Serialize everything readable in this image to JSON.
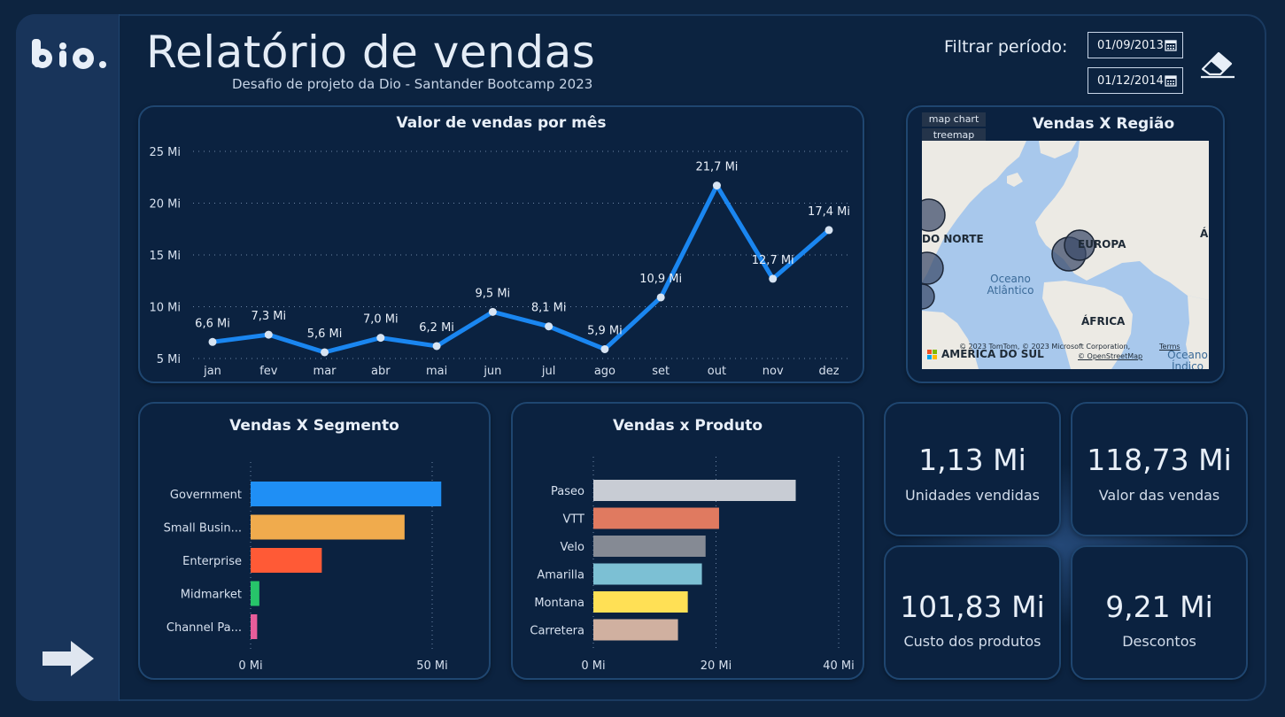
{
  "header": {
    "title": "Relatório de vendas",
    "subtitle": "Desafio de projeto da Dio - Santander Bootcamp 2023",
    "logo_text": "dio.",
    "filter_label": "Filtrar período:",
    "date_start": "01/09/2013",
    "date_end": "01/12/2014"
  },
  "line_card": {
    "title": "Valor de vendas por mês"
  },
  "map_card": {
    "title": "Vendas X Região",
    "tabs": [
      "map chart",
      "treemap"
    ],
    "labels": [
      "DO NORTE",
      "EUROPA",
      "ÁFRICA",
      "AMÉRICA DO SUL",
      "Á"
    ],
    "oceans": [
      "Oceano Atlântico",
      "Oceano Índico"
    ],
    "attribution": "© 2023 TomTom, © 2023 Microsoft Corporation,",
    "attribution2": "© OpenStreetMap",
    "terms": "Terms"
  },
  "segment_card": {
    "title": "Vendas X Segmento"
  },
  "product_card": {
    "title": "Vendas x Produto"
  },
  "kpis": [
    {
      "value": "1,13 Mi",
      "label": "Unidades vendidas"
    },
    {
      "value": "118,73 Mi",
      "label": "Valor das vendas"
    },
    {
      "value": "101,83 Mi",
      "label": "Custo dos produtos"
    },
    {
      "value": "9,21 Mi",
      "label": "Descontos"
    }
  ],
  "colors": {
    "line": "#1a86f0",
    "segments": [
      "#1f8ff5",
      "#f0ab4d",
      "#ff5a36",
      "#27c46a",
      "#e85d9a"
    ],
    "products": [
      "#c8ccd4",
      "#e07a60",
      "#858a94",
      "#7cc0d4",
      "#ffe055",
      "#d0b0a0"
    ]
  },
  "chart_data": [
    {
      "type": "line",
      "title": "Valor de vendas por mês",
      "categories": [
        "jan",
        "fev",
        "mar",
        "abr",
        "mai",
        "jun",
        "jul",
        "ago",
        "set",
        "out",
        "nov",
        "dez"
      ],
      "values": [
        6.6,
        7.3,
        5.6,
        7.0,
        6.2,
        9.5,
        8.1,
        5.9,
        10.9,
        21.7,
        12.7,
        17.4
      ],
      "data_labels": [
        "6,6 Mi",
        "7,3 Mi",
        "5,6 Mi",
        "7,0 Mi",
        "6,2 Mi",
        "9,5 Mi",
        "8,1 Mi",
        "5,9 Mi",
        "10,9 Mi",
        "21,7 Mi",
        "12,7 Mi",
        "17,4 Mi"
      ],
      "yticks": [
        5,
        10,
        15,
        20,
        25
      ],
      "ytick_labels": [
        "5 Mi",
        "10 Mi",
        "15 Mi",
        "20 Mi",
        "25 Mi"
      ],
      "ylim": [
        5,
        25
      ],
      "grid": true
    },
    {
      "type": "bar",
      "title": "Vendas X Segmento",
      "categories": [
        "Government",
        "Small Busin...",
        "Enterprise",
        "Midmarket",
        "Channel Pa..."
      ],
      "values": [
        52.5,
        42.4,
        19.6,
        2.4,
        1.8
      ],
      "xticks": [
        0,
        50
      ],
      "xtick_labels": [
        "0 Mi",
        "50 Mi"
      ],
      "xlim": [
        0,
        60
      ]
    },
    {
      "type": "bar",
      "title": "Vendas x Produto",
      "categories": [
        "Paseo",
        "VTT",
        "Velo",
        "Amarilla",
        "Montana",
        "Carretera"
      ],
      "values": [
        33.0,
        20.5,
        18.3,
        17.7,
        15.4,
        13.8
      ],
      "xticks": [
        0,
        20,
        40
      ],
      "xtick_labels": [
        "0 Mi",
        "20 Mi",
        "40 Mi"
      ],
      "xlim": [
        0,
        40
      ]
    }
  ]
}
